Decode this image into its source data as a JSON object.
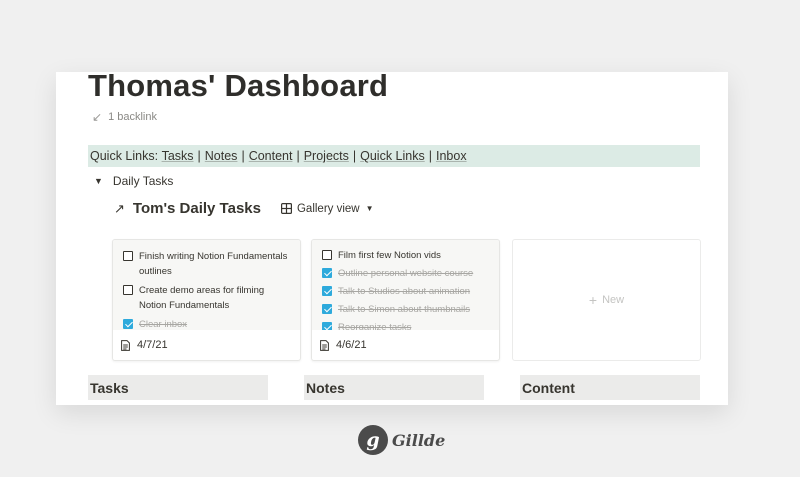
{
  "page": {
    "title": "Thomas' Dashboard",
    "backlink": "1 backlink"
  },
  "quick_links": {
    "prefix": "Quick Links: ",
    "items": [
      "Tasks",
      "Notes",
      "Content",
      "Projects",
      "Quick Links",
      "Inbox"
    ],
    "separator": "|"
  },
  "toggle": {
    "label": "Daily Tasks"
  },
  "database": {
    "link_arrow": "↗",
    "title": "Tom's Daily Tasks",
    "view_label": "Gallery view"
  },
  "cards": [
    {
      "todos": [
        {
          "text": "Finish writing Notion Fundamentals outlines",
          "checked": false
        },
        {
          "text": "Create demo areas for filming Notion Fundamentals",
          "checked": false
        },
        {
          "text": "Clear inbox",
          "checked": true
        }
      ],
      "date": "4/7/21"
    },
    {
      "todos": [
        {
          "text": "Film first few Notion vids",
          "checked": false
        },
        {
          "text": "Outline personal website course",
          "checked": true
        },
        {
          "text": "Talk to Studios about animation",
          "checked": true
        },
        {
          "text": "Talk to Simon about thumbnails",
          "checked": true
        },
        {
          "text": "Reorganize tasks",
          "checked": true
        }
      ],
      "date": "4/6/21"
    }
  ],
  "new_card": {
    "label": "New"
  },
  "columns": [
    "Tasks",
    "Notes",
    "Content"
  ],
  "watermark": {
    "badge": "g",
    "text": "Gillde"
  },
  "colors": {
    "quick_links_bg": "#dcebe5",
    "checkbox_checked": "#2eaadc",
    "column_header_bg": "#ebebea"
  }
}
